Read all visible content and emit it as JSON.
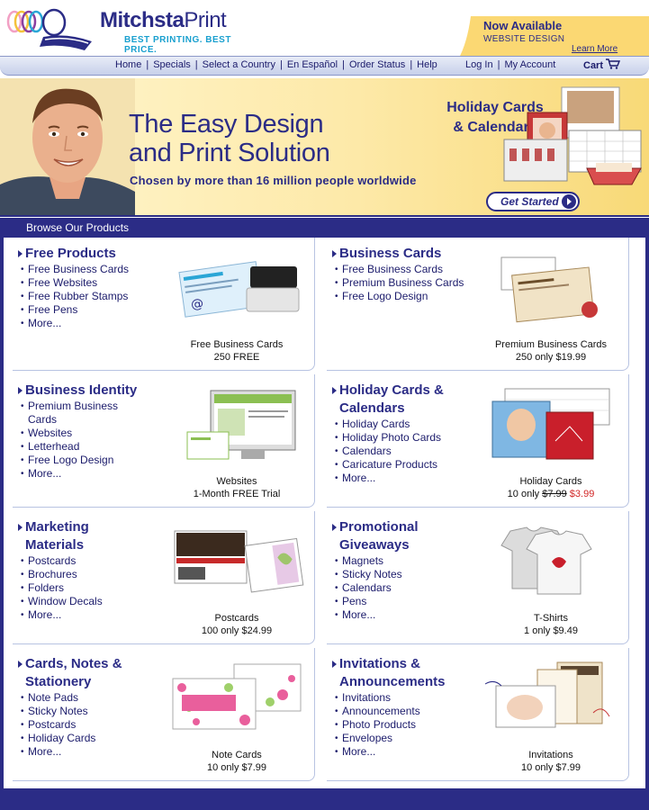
{
  "brand": {
    "name_bold": "Mitchsta",
    "name_light": "Print",
    "tagline": "BEST PRINTING. BEST PRICE."
  },
  "promo": {
    "title": "Now Available",
    "subtitle": "WEBSITE DESIGN",
    "link": "Learn More"
  },
  "nav": {
    "left": [
      "Home",
      "Specials",
      "Select a Country",
      "En Español",
      "Order Status",
      "Help"
    ],
    "right": [
      "Log In",
      "My Account"
    ],
    "cart": "Cart"
  },
  "hero": {
    "title_line1": "The Easy Design",
    "title_line2": "and Print Solution",
    "subtitle": "Chosen by more than 16 million people worldwide",
    "badge_line1": "Holiday Cards",
    "badge_line2": "& Calendars",
    "cta": "Get Started"
  },
  "browse_title": "Browse Our Products",
  "products": [
    {
      "title": "Free Products",
      "items": [
        "Free Business Cards",
        "Free Websites",
        "Free Rubber Stamps",
        "Free Pens",
        "More..."
      ],
      "caption1": "Free Business Cards",
      "caption2": "250 FREE"
    },
    {
      "title": "Business Cards",
      "items": [
        "Free Business Cards",
        "Premium Business Cards",
        "Free Logo Design"
      ],
      "caption1": "Premium Business Cards",
      "caption2": "250 only $19.99"
    },
    {
      "title": "Business Identity",
      "items": [
        "Premium Business Cards",
        "Websites",
        "Letterhead",
        "Free Logo Design",
        "More..."
      ],
      "caption1": "Websites",
      "caption2": "1-Month FREE Trial"
    },
    {
      "title": "Holiday Cards & Calendars",
      "items": [
        "Holiday Cards",
        "Holiday Photo Cards",
        "Calendars",
        "Caricature Products",
        "More..."
      ],
      "caption1": "Holiday Cards",
      "caption2_prefix": "10 only ",
      "caption2_old": "$7.99",
      "caption2_new": "$3.99"
    },
    {
      "title": "Marketing Materials",
      "items": [
        "Postcards",
        "Brochures",
        "Folders",
        "Window Decals",
        "More..."
      ],
      "caption1": "Postcards",
      "caption2": "100 only $24.99"
    },
    {
      "title": "Promotional Giveaways",
      "items": [
        "Magnets",
        "Sticky Notes",
        "Calendars",
        "Pens",
        "More..."
      ],
      "caption1": "T-Shirts",
      "caption2": "1 only $9.49"
    },
    {
      "title": "Cards, Notes & Stationery",
      "items": [
        "Note Pads",
        "Sticky Notes",
        "Postcards",
        "Holiday Cards",
        "More..."
      ],
      "caption1": "Note Cards",
      "caption2": "10 only $7.99"
    },
    {
      "title": "Invitations & Announcements",
      "items": [
        "Invitations",
        "Announcements",
        "Photo Products",
        "Envelopes",
        "More..."
      ],
      "caption1": "Invitations",
      "caption2": "10 only $7.99"
    }
  ],
  "colors": {
    "primary": "#2b2c86",
    "accent": "#1aa0cf",
    "sale": "#d12727",
    "hero_bg": "#fde9a8"
  }
}
